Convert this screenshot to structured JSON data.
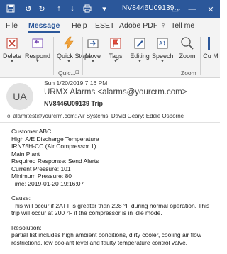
{
  "titlebar": {
    "title": "NV8446U09139...",
    "icons": [
      "save-icon",
      "undo-icon",
      "up-arrow-icon",
      "down-arrow-icon",
      "print-icon",
      "chevron-down-icon"
    ],
    "window_buttons": [
      "restore-icon",
      "minimize-icon",
      "maximize-icon",
      "close-icon"
    ]
  },
  "tabs": [
    {
      "label": "File"
    },
    {
      "label": "Message",
      "active": true
    },
    {
      "label": "Help"
    },
    {
      "label": "ESET"
    },
    {
      "label": "Adobe PDF"
    },
    {
      "label": "Tell me"
    }
  ],
  "ribbon": {
    "buttons": [
      {
        "label": "Delete",
        "icon": "delete-icon"
      },
      {
        "label": "Respond",
        "icon": "respond-icon"
      },
      {
        "label": "Quick Steps",
        "icon": "quick-steps-icon"
      },
      {
        "label": "Move",
        "icon": "move-icon"
      },
      {
        "label": "Tags",
        "icon": "flag-icon"
      },
      {
        "label": "Editing",
        "icon": "editing-icon"
      },
      {
        "label": "Speech",
        "icon": "speech-icon"
      },
      {
        "label": "Zoom",
        "icon": "zoom-icon"
      },
      {
        "label": "Cu M",
        "icon": "customize-icon"
      }
    ],
    "groups": {
      "quick": "Quic...",
      "zoom": "Zoom"
    }
  },
  "message": {
    "avatar": "UA",
    "date": "Sun 1/20/2019 7:16 PM",
    "from": "URMX Alarms <alarms@yourcrm.com>",
    "subject": "NV8446U09139 Trip",
    "to_label": "To",
    "to": "alarmtest@yourcrm.com; Air Systems; David Geary; Eddie Osborne"
  },
  "body": {
    "lines": [
      "Customer ABC",
      "High A/E Discharge Temperature",
      "IRN75H-CC (Air Compressor 1)",
      "Main Plant",
      "Required Response: Send Alerts",
      "Current Pressure: 101",
      "Minimum Pressure: 80",
      "Time: 2019-01-20 19:16:07"
    ],
    "cause_label": "Cause:",
    "cause_text": "This will occur if 2ATT is greater than 228 °F during normal operation. This trip will occur at 200 °F if the compressor is in idle mode.",
    "resolution_label": "Resolution:",
    "resolution_text": "partial list includes high ambient conditions, dirty cooler, cooling air flow restrictions, low coolant level and faulty temperature control valve."
  }
}
